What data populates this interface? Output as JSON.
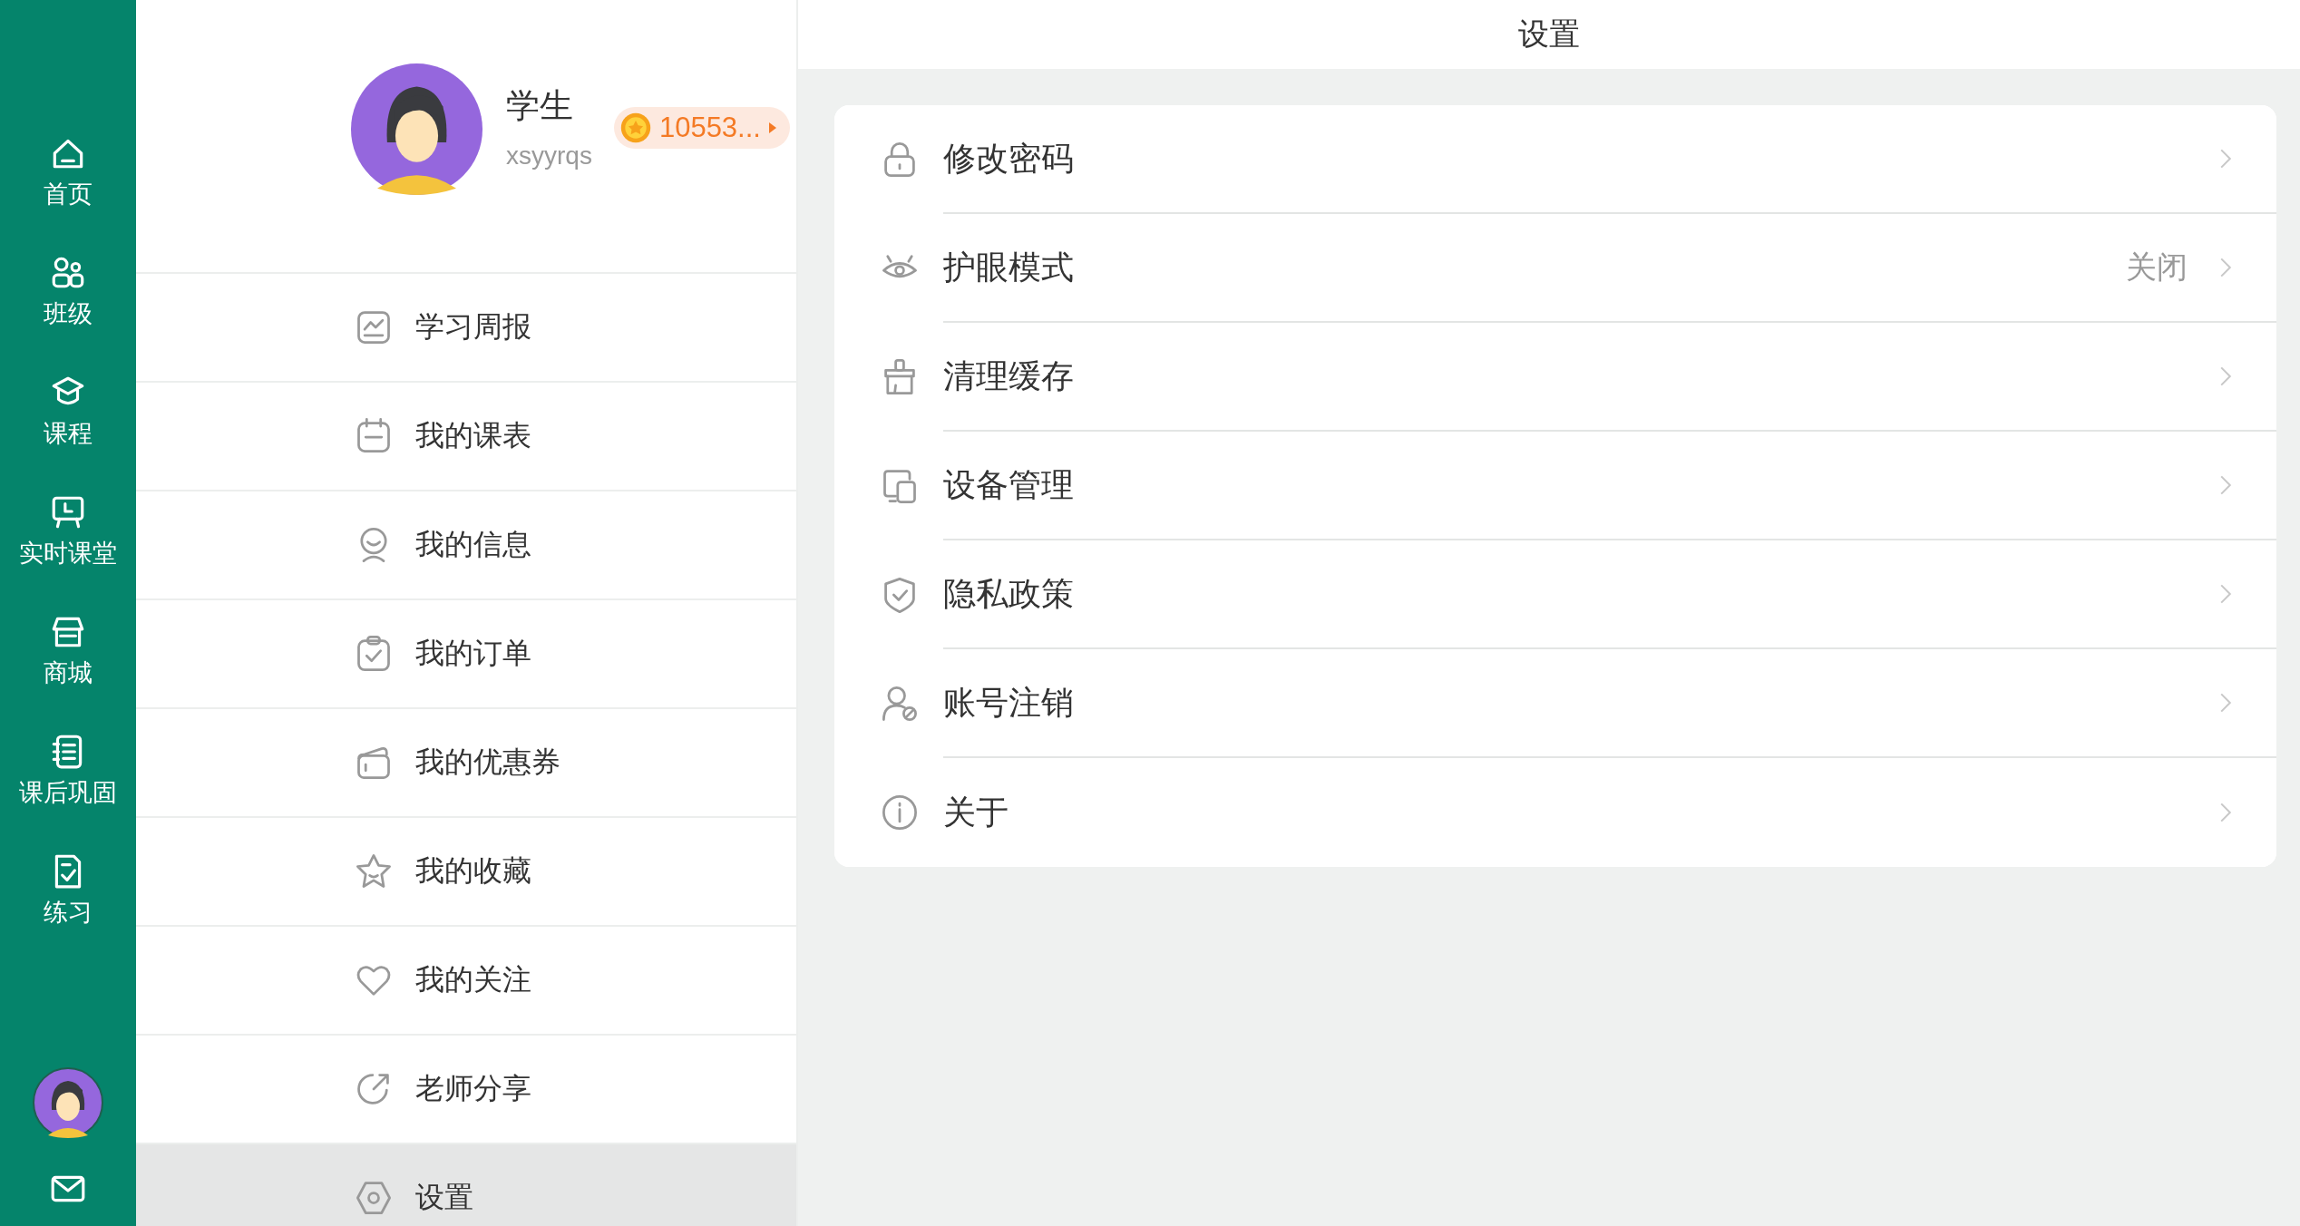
{
  "nav": {
    "items": [
      {
        "label": "首页"
      },
      {
        "label": "班级"
      },
      {
        "label": "课程"
      },
      {
        "label": "实时课堂"
      },
      {
        "label": "商城"
      },
      {
        "label": "课后巩固"
      },
      {
        "label": "练习"
      }
    ]
  },
  "profile": {
    "name": "学生",
    "username": "xsyyrqs",
    "coins": "10553..."
  },
  "menu": [
    {
      "label": "学习周报",
      "selected": false
    },
    {
      "label": "我的课表",
      "selected": false
    },
    {
      "label": "我的信息",
      "selected": false
    },
    {
      "label": "我的订单",
      "selected": false
    },
    {
      "label": "我的优惠券",
      "selected": false
    },
    {
      "label": "我的收藏",
      "selected": false
    },
    {
      "label": "我的关注",
      "selected": false
    },
    {
      "label": "老师分享",
      "selected": false
    },
    {
      "label": "设置",
      "selected": true
    }
  ],
  "header": {
    "title": "设置"
  },
  "settings": [
    {
      "label": "修改密码"
    },
    {
      "label": "护眼模式",
      "value": "关闭"
    },
    {
      "label": "清理缓存"
    },
    {
      "label": "设备管理"
    },
    {
      "label": "隐私政策"
    },
    {
      "label": "账号注销"
    },
    {
      "label": "关于"
    }
  ]
}
